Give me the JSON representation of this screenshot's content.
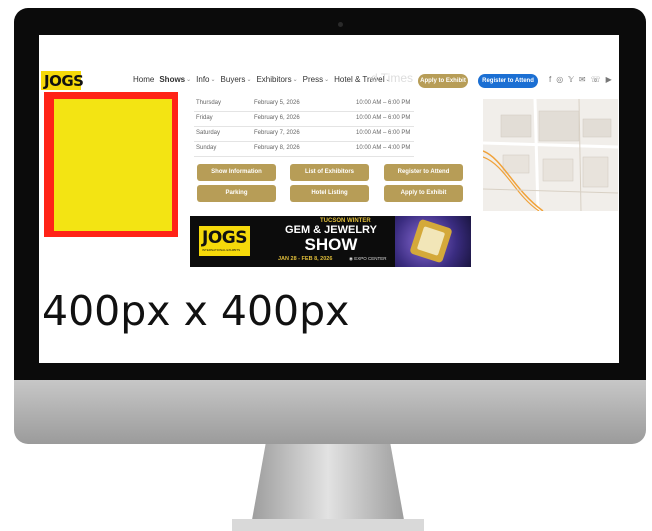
{
  "nav": {
    "logo": "JOGS",
    "items": [
      "Home",
      "Shows",
      "Info",
      "Buyers",
      "Exhibitors",
      "Press",
      "Hotel & Travel"
    ],
    "faded_heading": "d Times",
    "apply_button": "Apply to Exhibit",
    "register_button": "Register to Attend",
    "social_icons": [
      "f",
      "◎",
      "𝕐",
      "✉",
      "☏",
      "▶"
    ]
  },
  "schedule": [
    {
      "day": "Thursday",
      "date": "February 5, 2026",
      "time": "10:00 AM – 6:00 PM"
    },
    {
      "day": "Friday",
      "date": "February 6, 2026",
      "time": "10:00 AM – 6:00 PM"
    },
    {
      "day": "Saturday",
      "date": "February 7, 2026",
      "time": "10:00 AM – 6:00 PM"
    },
    {
      "day": "Sunday",
      "date": "February 8, 2026",
      "time": "10:00 AM – 4:00 PM"
    }
  ],
  "buttons": [
    "Show Information",
    "List of Exhibitors",
    "Register to Attend",
    "Parking",
    "Hotel Listing",
    "Apply to Exhibit"
  ],
  "banner": {
    "logo": "JOGS",
    "logo_sub": "INTERNATIONAL EXHIBITS",
    "kicker": "TUCSON WINTER",
    "title1": "GEM & JEWELRY",
    "title2": "SHOW",
    "dates": "JAN 28 - FEB 8, 2026",
    "venue": "EXPO CENTER"
  },
  "size_label": "400px x 400px",
  "colors": {
    "gold": "#b79d57",
    "blue": "#1b6fd3",
    "yellow": "#f3e413",
    "red": "#ff2317"
  }
}
